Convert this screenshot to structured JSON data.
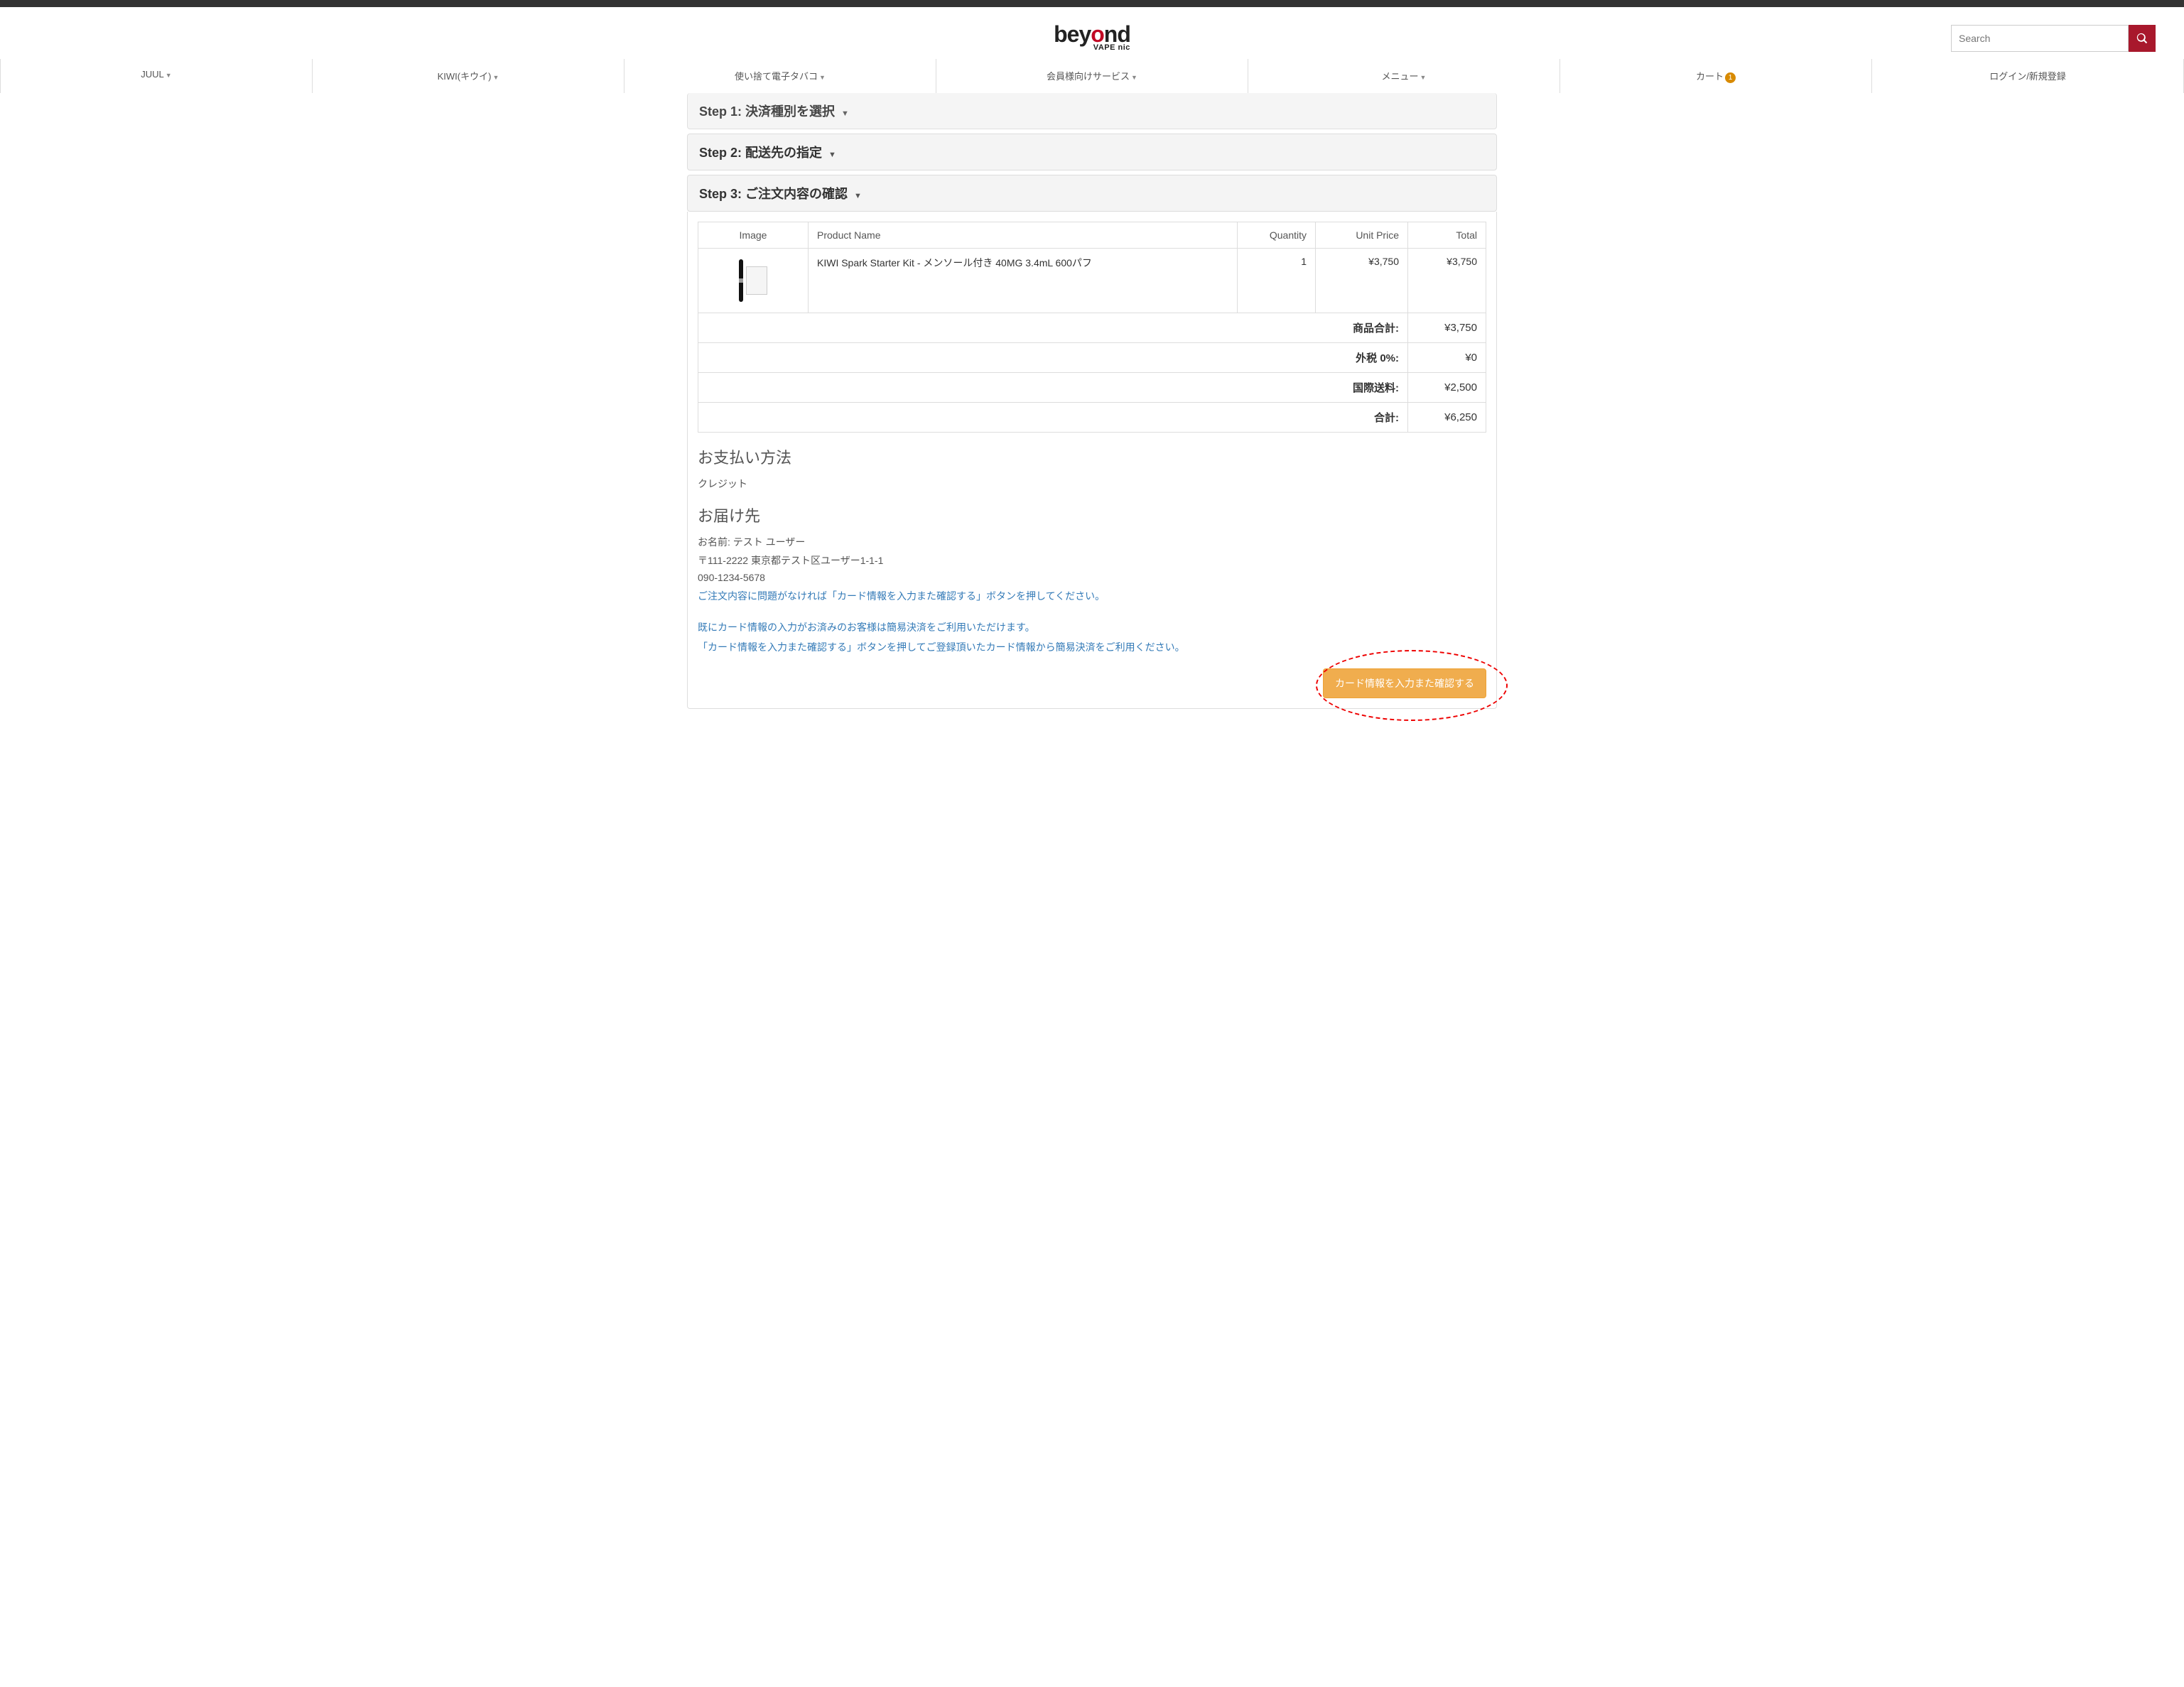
{
  "search": {
    "placeholder": "Search"
  },
  "nav": {
    "items": [
      {
        "label": "JUUL",
        "caret": true
      },
      {
        "label": "KIWI(キウイ)",
        "caret": true
      },
      {
        "label": "使い捨て電子タバコ",
        "caret": true
      },
      {
        "label": "会員様向けサービス",
        "caret": true
      },
      {
        "label": "メニュー",
        "caret": true
      }
    ],
    "cart": {
      "label": "カート",
      "count": "1"
    },
    "login": {
      "label": "ログイン/新規登録"
    }
  },
  "steps": {
    "s1": "Step 1: 決済種別を選択",
    "s2": "Step 2: 配送先の指定",
    "s3": "Step 3: ご注文内容の確認"
  },
  "table": {
    "headers": {
      "image": "Image",
      "name": "Product Name",
      "qty": "Quantity",
      "unit": "Unit Price",
      "total": "Total"
    },
    "row": {
      "name": "KIWI Spark Starter Kit - メンソール付き 40MG 3.4mL 600パフ",
      "qty": "1",
      "unit": "¥3,750",
      "total": "¥3,750"
    },
    "summary": [
      {
        "label": "商品合計:",
        "val": "¥3,750"
      },
      {
        "label": "外税 0%:",
        "val": "¥0"
      },
      {
        "label": "国際送料:",
        "val": "¥2,500"
      },
      {
        "label": "合計:",
        "val": "¥6,250"
      }
    ]
  },
  "payment": {
    "heading": "お支払い方法",
    "method": "クレジット"
  },
  "shipping": {
    "heading": "お届け先",
    "name": "お名前: テスト ユーザー",
    "address": "〒111-2222 東京都テスト区ユーザー1-1-1",
    "phone": "090-1234-5678"
  },
  "notes": {
    "n1": "ご注文内容に問題がなければ「カード情報を入力また確認する」ボタンを押してください。",
    "n2": "既にカード情報の入力がお済みのお客様は簡易決済をご利用いただけます。",
    "n3": "「カード情報を入力また確認する」ボタンを押してご登録頂いたカード情報から簡易決済をご利用ください。"
  },
  "button": {
    "confirm": "カード情報を入力また確認する"
  },
  "logo": {
    "main1": "bey",
    "main2": "o",
    "main3": "nd",
    "sub": "VAPE nic"
  }
}
